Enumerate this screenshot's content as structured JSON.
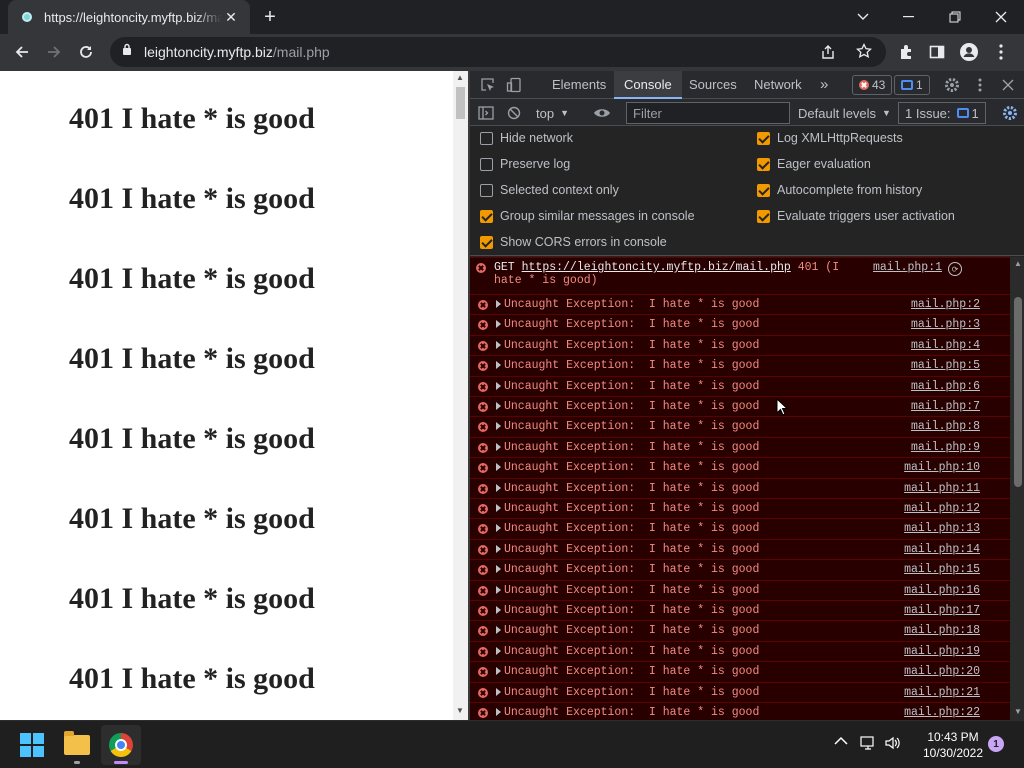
{
  "browser": {
    "tab_title": "https://leightoncity.myftp.biz/mail.php",
    "url_domain": "leightoncity.myftp.biz",
    "url_path": "/mail.php"
  },
  "page": {
    "headings": [
      "401 I hate * is good",
      "401 I hate * is good",
      "401 I hate * is good",
      "401 I hate * is good",
      "401 I hate * is good",
      "401 I hate * is good",
      "401 I hate * is good",
      "401 I hate * is good"
    ]
  },
  "devtools": {
    "tabs": [
      "Elements",
      "Console",
      "Sources",
      "Network"
    ],
    "active_tab": "Console",
    "error_count": "43",
    "message_count": "1",
    "context": "top",
    "filter_placeholder": "Filter",
    "levels": "Default levels",
    "issues_label": "1 Issue:",
    "issues_count": "1",
    "settings_left": [
      {
        "label": "Hide network",
        "checked": false
      },
      {
        "label": "Preserve log",
        "checked": false
      },
      {
        "label": "Selected context only",
        "checked": false
      },
      {
        "label": "Group similar messages in console",
        "checked": true
      },
      {
        "label": "Show CORS errors in console",
        "checked": true
      }
    ],
    "settings_right": [
      {
        "label": "Log XMLHttpRequests",
        "checked": true
      },
      {
        "label": "Eager evaluation",
        "checked": true
      },
      {
        "label": "Autocomplete from history",
        "checked": true
      },
      {
        "label": "Evaluate triggers user activation",
        "checked": true
      }
    ],
    "first_error": {
      "method": "GET",
      "url": "https://leightoncity.myftp.biz/mail.php",
      "status": "401 (I hate * is good)",
      "source": "mail.php:1"
    },
    "exception_text": "Uncaught Exception:  I hate * is good",
    "exception_sources": [
      "mail.php:2",
      "mail.php:3",
      "mail.php:4",
      "mail.php:5",
      "mail.php:6",
      "mail.php:7",
      "mail.php:8",
      "mail.php:9",
      "mail.php:10",
      "mail.php:11",
      "mail.php:12",
      "mail.php:13",
      "mail.php:14",
      "mail.php:15",
      "mail.php:16",
      "mail.php:17",
      "mail.php:18",
      "mail.php:19",
      "mail.php:20",
      "mail.php:21",
      "mail.php:22"
    ]
  },
  "taskbar": {
    "time": "10:43 PM",
    "date": "10/30/2022",
    "notifications": "1"
  }
}
